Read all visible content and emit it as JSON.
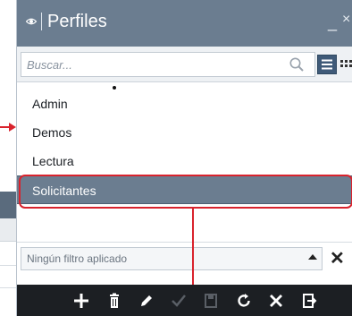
{
  "window": {
    "title": "Perfiles",
    "minimize": "_",
    "close": "×"
  },
  "search": {
    "placeholder": "Buscar..."
  },
  "list": {
    "items": [
      {
        "label": "Admin",
        "selected": false
      },
      {
        "label": "Demos",
        "selected": false
      },
      {
        "label": "Lectura",
        "selected": false
      },
      {
        "label": "Solicitantes",
        "selected": true
      }
    ]
  },
  "filter": {
    "text": "Ningún filtro aplicado",
    "clear": "✕"
  },
  "colors": {
    "titlebar": "#6b7d90",
    "toolbar": "#1c1f23",
    "annotation": "#d9232d",
    "selected_row": "#6b7d90"
  },
  "toolbar": {
    "icons": [
      "add-icon",
      "delete-icon",
      "edit-icon",
      "confirm-icon",
      "save-icon",
      "refresh-icon",
      "cancel-icon",
      "export-icon"
    ]
  }
}
